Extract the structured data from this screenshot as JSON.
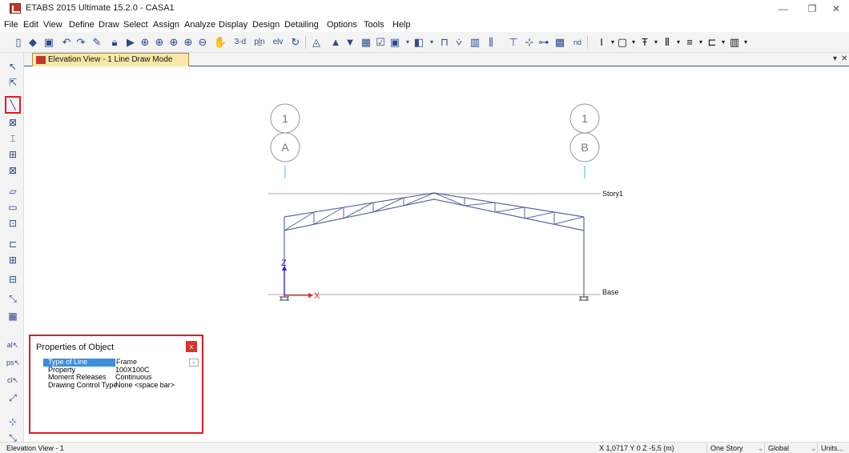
{
  "window": {
    "title": "ETABS 2015 Ultimate 15.2.0 - CASA1",
    "minimize": "—",
    "restore": "❐",
    "close": "✕"
  },
  "menu": [
    "File",
    "Edit",
    "View",
    "Define",
    "Draw",
    "Select",
    "Assign",
    "Analyze",
    "Display",
    "Design",
    "Detailing",
    "Options",
    "Tools",
    "Help"
  ],
  "toolbar": {
    "view_3d": "3-d",
    "plan": "pl̲n",
    "elev": "elv",
    "nd": "nd"
  },
  "tab": {
    "label": "Elevation View - 1  Line Draw Mode",
    "menu_arrow": "▾",
    "close": "✕"
  },
  "grid": {
    "bubbles": [
      {
        "top": "1",
        "bottom": "A"
      },
      {
        "top": "1",
        "bottom": "B"
      }
    ],
    "stories": [
      "Story1",
      "Base"
    ],
    "axes": {
      "z": "Z",
      "x": "X"
    }
  },
  "properties": {
    "title": "Properties of Object",
    "close": "x",
    "rows": [
      {
        "key": "Type of Line",
        "value": "Frame"
      },
      {
        "key": "Property",
        "value": "100X100C"
      },
      {
        "key": "Moment Releases",
        "value": "Continuous"
      },
      {
        "key": "Drawing Control Type",
        "value": "None  <space bar>"
      }
    ],
    "dropdown_arrow": "⌄"
  },
  "status": {
    "view": "Elevation View - 1",
    "coords": "X 1,0717  Y 0  Z -5,5 (m)",
    "story": "One Story",
    "system": "Global",
    "units": "Units..."
  },
  "colors": {
    "frame": "#5a6a9a",
    "grid_line": "#33cccc",
    "highlight": "#d81e2a",
    "axis_z": "#1a1aff",
    "axis_x": "#ff1a1a"
  }
}
